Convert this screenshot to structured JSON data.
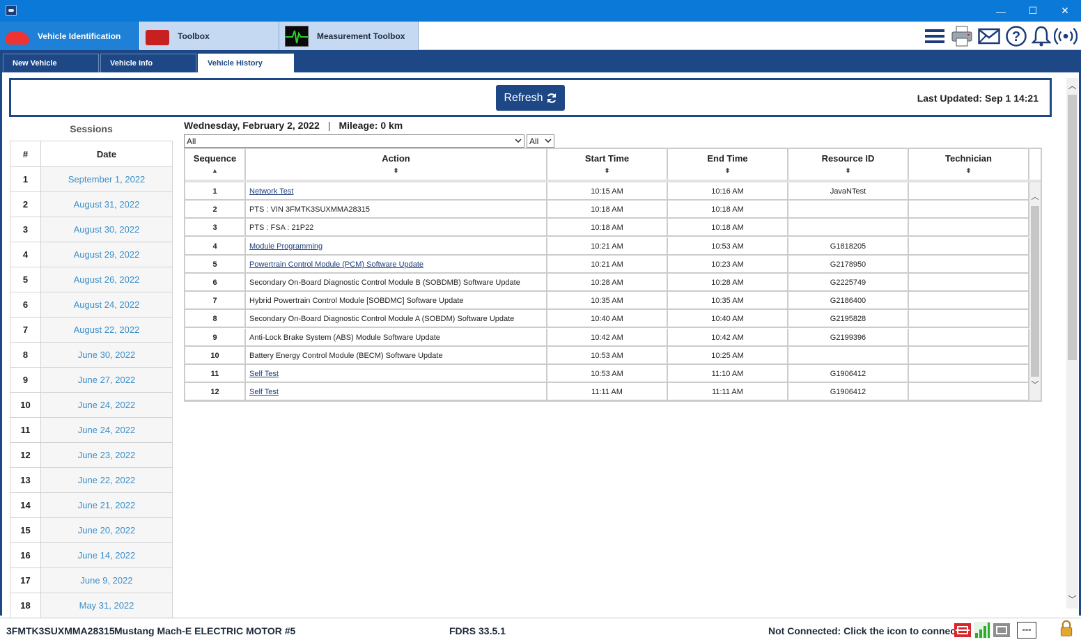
{
  "window": {
    "minimize": "—",
    "maximize": "☐",
    "close": "✕"
  },
  "top_tabs": [
    {
      "label": "Vehicle Identification",
      "icon": "car-icon"
    },
    {
      "label": "Toolbox",
      "icon": "toolbox-icon"
    },
    {
      "label": "Measurement Toolbox",
      "icon": "waveform-icon"
    }
  ],
  "header_icons": [
    "menu-icon",
    "printer-icon",
    "mail-icon",
    "help-icon",
    "bell-icon",
    "wireless-icon"
  ],
  "sub_tabs": [
    "New Vehicle",
    "Vehicle Info",
    "Vehicle History"
  ],
  "refresh": {
    "label": "Refresh",
    "icon": "refresh-icon"
  },
  "last_updated": "Last Updated:  Sep 1 14:21",
  "sessions": {
    "title": "Sessions",
    "col_num": "#",
    "col_date": "Date",
    "rows": [
      {
        "num": "1",
        "date": "September 1, 2022"
      },
      {
        "num": "2",
        "date": "August 31, 2022"
      },
      {
        "num": "3",
        "date": "August 30, 2022"
      },
      {
        "num": "4",
        "date": "August 29, 2022"
      },
      {
        "num": "5",
        "date": "August 26, 2022"
      },
      {
        "num": "6",
        "date": "August 24, 2022"
      },
      {
        "num": "7",
        "date": "August 22, 2022"
      },
      {
        "num": "8",
        "date": "June 30, 2022"
      },
      {
        "num": "9",
        "date": "June 27, 2022"
      },
      {
        "num": "10",
        "date": "June 24, 2022"
      },
      {
        "num": "11",
        "date": "June 24, 2022"
      },
      {
        "num": "12",
        "date": "June 23, 2022"
      },
      {
        "num": "13",
        "date": "June 22, 2022"
      },
      {
        "num": "14",
        "date": "June 21, 2022"
      },
      {
        "num": "15",
        "date": "June 20, 2022"
      },
      {
        "num": "16",
        "date": "June 14, 2022"
      },
      {
        "num": "17",
        "date": "June 9, 2022"
      },
      {
        "num": "18",
        "date": "May 31, 2022"
      }
    ]
  },
  "session_detail": {
    "date": "Wednesday, February 2, 2022",
    "separator": "|",
    "mileage": "Mileage: 0 km",
    "filter1": "All",
    "filter2": "All"
  },
  "grid": {
    "columns": [
      "Sequence",
      "Action",
      "Start Time",
      "End Time",
      "Resource ID",
      "Technician"
    ],
    "sort_asc": "▲",
    "sort_both": "⬍",
    "rows": [
      {
        "seq": "1",
        "action": "Network Test",
        "link": true,
        "start": "10:15 AM",
        "end": "10:16 AM",
        "resource": "JavaNTest",
        "tech": ""
      },
      {
        "seq": "2",
        "action": "PTS : VIN 3FMTK3SUXMMA28315",
        "link": false,
        "start": "10:18 AM",
        "end": "10:18 AM",
        "resource": "",
        "tech": ""
      },
      {
        "seq": "3",
        "action": "PTS : FSA : 21P22",
        "link": false,
        "start": "10:18 AM",
        "end": "10:18 AM",
        "resource": "",
        "tech": ""
      },
      {
        "seq": "4",
        "action": "Module Programming",
        "link": true,
        "start": "10:21 AM",
        "end": "10:53 AM",
        "resource": "G1818205",
        "tech": ""
      },
      {
        "seq": "5",
        "action": "Powertrain Control Module (PCM) Software Update",
        "link": true,
        "start": "10:21 AM",
        "end": "10:23 AM",
        "resource": "G2178950",
        "tech": ""
      },
      {
        "seq": "6",
        "action": "Secondary On-Board Diagnostic Control Module B (SOBDMB) Software Update",
        "link": false,
        "start": "10:28 AM",
        "end": "10:28 AM",
        "resource": "G2225749",
        "tech": ""
      },
      {
        "seq": "7",
        "action": "Hybrid Powertrain Control Module [SOBDMC] Software Update",
        "link": false,
        "start": "10:35 AM",
        "end": "10:35 AM",
        "resource": "G2186400",
        "tech": ""
      },
      {
        "seq": "8",
        "action": "Secondary On-Board Diagnostic Control Module A (SOBDM) Software Update",
        "link": false,
        "start": "10:40 AM",
        "end": "10:40 AM",
        "resource": "G2195828",
        "tech": ""
      },
      {
        "seq": "9",
        "action": "Anti-Lock Brake System (ABS) Module Software Update",
        "link": false,
        "start": "10:42 AM",
        "end": "10:42 AM",
        "resource": "G2199396",
        "tech": ""
      },
      {
        "seq": "10",
        "action": "Battery Energy Control Module (BECM) Software Update",
        "link": false,
        "start": "10:53 AM",
        "end": "10:25 AM",
        "resource": "",
        "tech": ""
      },
      {
        "seq": "11",
        "action": "Self Test",
        "link": true,
        "start": "10:53 AM",
        "end": "11:10 AM",
        "resource": "G1906412",
        "tech": ""
      },
      {
        "seq": "12",
        "action": "Self Test",
        "link": true,
        "start": "11:11 AM",
        "end": "11:11 AM",
        "resource": "G1906412",
        "tech": ""
      }
    ]
  },
  "status": {
    "vin": "3FMTK3SUXMMA28315",
    "vehicle": "Mustang Mach-E ELECTRIC MOTOR #5",
    "version": "FDRS 33.5.1",
    "connection": "Not Connected: Click the icon to connect.",
    "indicator": "---",
    "icons": [
      "vci-red-icon",
      "signal-bars-icon",
      "vci-gray-icon",
      "lock-icon"
    ]
  },
  "colors": {
    "brand_navy": "#1d4885",
    "titlebar": "#0a79d8",
    "link_blue": "#3a8ec9",
    "active_tab": "#1e80d6"
  }
}
